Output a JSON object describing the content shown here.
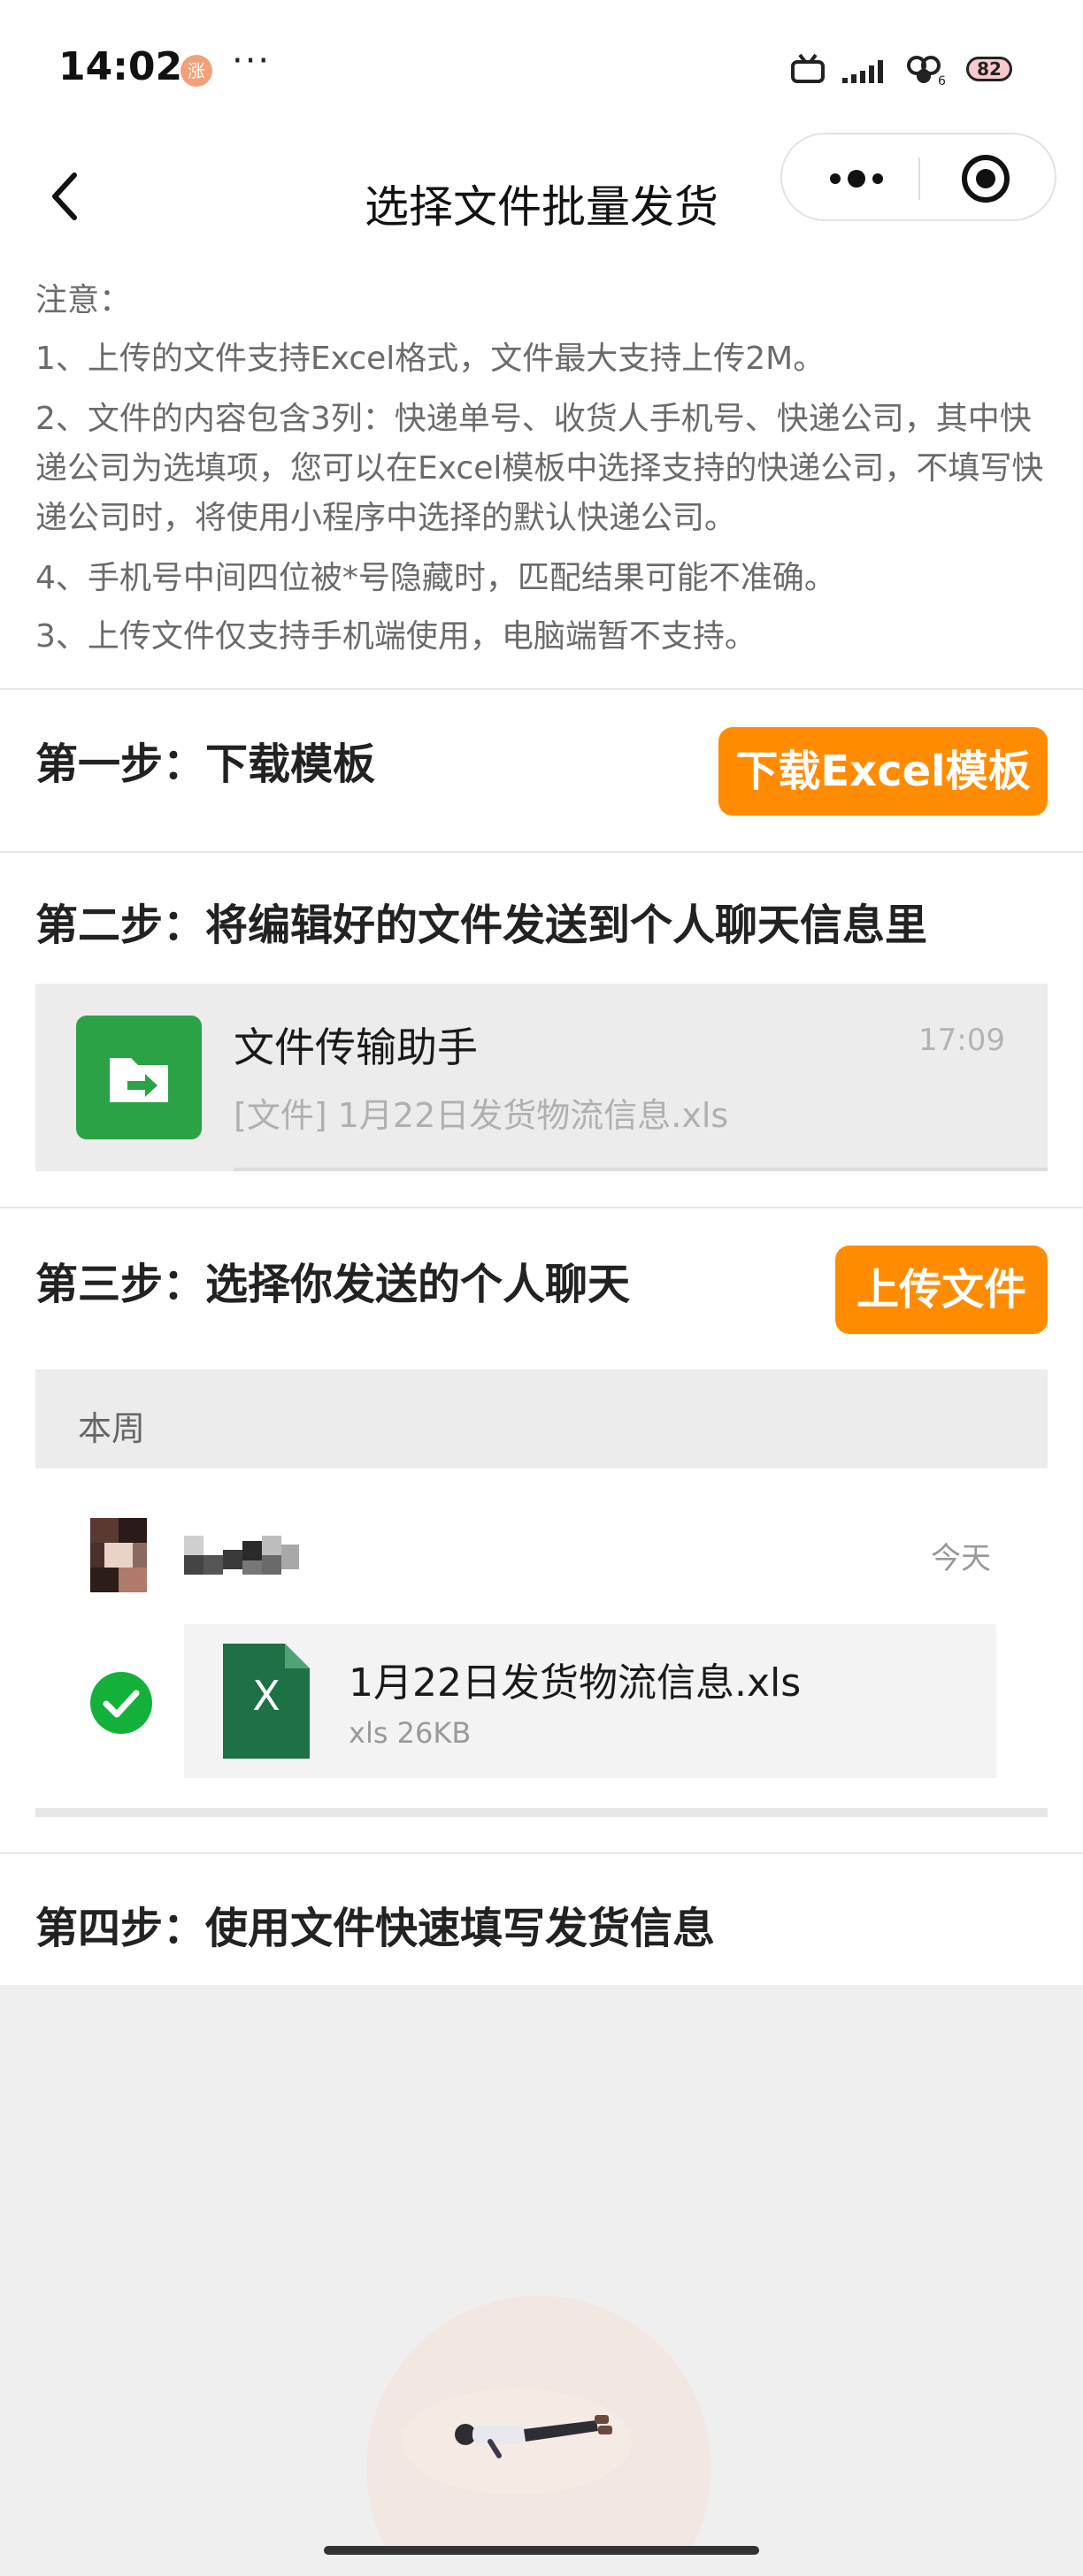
{
  "status_bar": {
    "time": "14:02",
    "notification_badge": "涨",
    "more": "···",
    "battery": "82"
  },
  "nav": {
    "title": "选择文件批量发货",
    "menu_icon": "more-dots-icon",
    "close_icon": "target-close-icon"
  },
  "notes": {
    "heading": "注意：",
    "lines": [
      "1、上传的文件支持Excel格式，文件最大支持上传2M。",
      "2、文件的内容包含3列：快递单号、收货人手机号、快递公司，其中快递公司为选填项，您可以在Excel模板中选择支持的快递公司，不填写快递公司时，将使用小程序中选择的默认快递公司。",
      "4、手机号中间四位被*号隐藏时，匹配结果可能不准确。",
      "3、上传文件仅支持手机端使用，电脑端暂不支持。"
    ]
  },
  "step1": {
    "title": "第一步：下载模板",
    "button": "下载Excel模板"
  },
  "step2": {
    "title": "第二步：将编辑好的文件发送到个人聊天信息里",
    "chat": {
      "name": "文件传输助手",
      "time": "17:09",
      "preview": "[文件] 1月22日发货物流信息.xls"
    }
  },
  "step3": {
    "title": "第三步：选择你发送的个人聊天",
    "button": "上传文件",
    "section_label": "本周",
    "day": "今天",
    "file": {
      "name": "1月22日发货物流信息.xls",
      "meta": "xls 26KB",
      "icon_letter": "X"
    }
  },
  "step4": {
    "title": "第四步：使用文件快速填写发货信息"
  },
  "colors": {
    "accent": "#ff8c00",
    "green": "#2ba245",
    "excel": "#1e7145"
  }
}
